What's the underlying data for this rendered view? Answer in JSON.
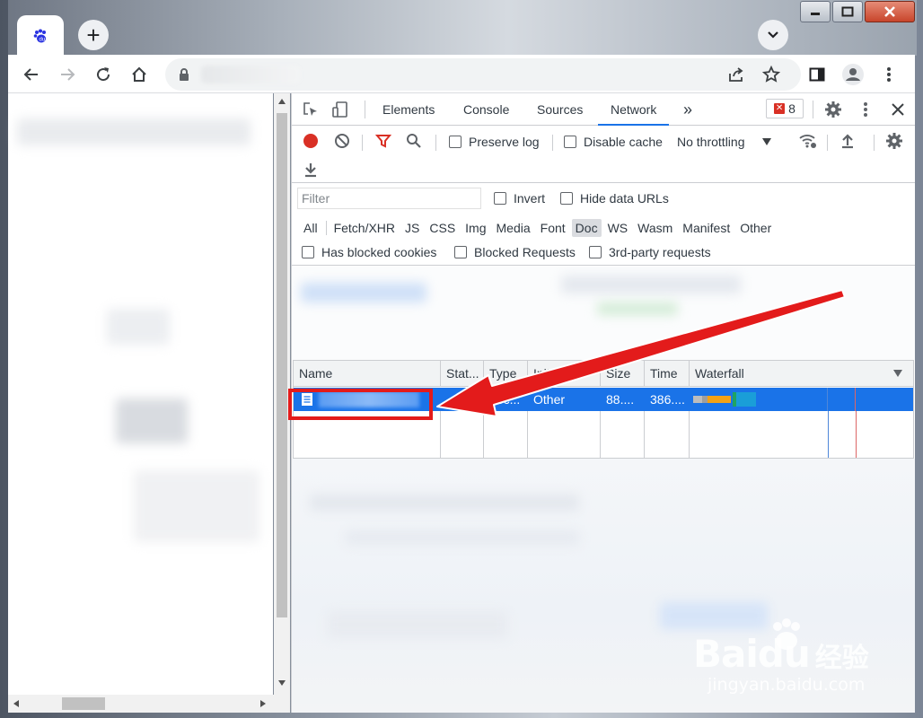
{
  "devtools": {
    "tabs": [
      {
        "label": "Elements"
      },
      {
        "label": "Console"
      },
      {
        "label": "Sources"
      },
      {
        "label": "Network"
      }
    ],
    "more_tabs": "»",
    "error_count": "8"
  },
  "network_toolbar": {
    "preserve_log": "Preserve log",
    "disable_cache": "Disable cache",
    "throttling": "No throttling"
  },
  "filter": {
    "placeholder": "Filter",
    "invert": "Invert",
    "hide_data_urls": "Hide data URLs",
    "types": [
      "All",
      "Fetch/XHR",
      "JS",
      "CSS",
      "Img",
      "Media",
      "Font",
      "Doc",
      "WS",
      "Wasm",
      "Manifest",
      "Other"
    ],
    "selected_type": "Doc",
    "has_blocked_cookies": "Has blocked cookies",
    "blocked_requests": "Blocked Requests",
    "third_party": "3rd-party requests"
  },
  "table": {
    "columns": [
      "Name",
      "Stat...",
      "Type",
      "Initiator",
      "Size",
      "Time",
      "Waterfall"
    ],
    "row": {
      "type": "doc...",
      "initiator": "Other",
      "size": "88....",
      "time": "386...."
    }
  },
  "watermark": {
    "brand": "Baidu",
    "subtitle_cn": "经验",
    "url": "jingyan.baidu.com"
  },
  "colors": {
    "accent": "#1a73e8",
    "annotation_red": "#e31b1b",
    "record_red": "#d93025"
  }
}
